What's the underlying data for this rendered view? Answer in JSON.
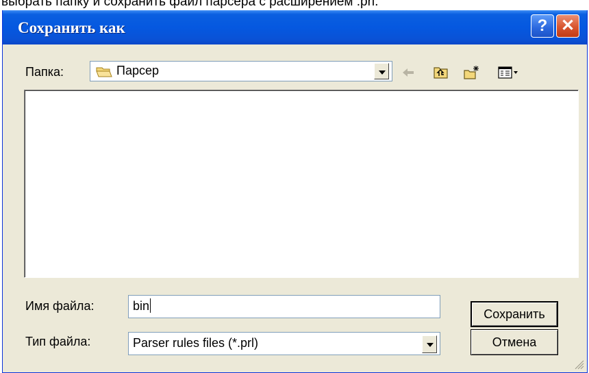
{
  "caption": "выбрать папку и сохранить файл парсера с расширением .prl.",
  "dialog": {
    "title": "Сохранить как",
    "help_label": "?",
    "close_label": "✕",
    "folder_label": "Папка:",
    "folder_value": "Парсер",
    "filename_label": "Имя файла:",
    "filename_value": "bin",
    "filetype_label": "Тип файла:",
    "filetype_value": "Parser rules files (*.prl)",
    "save_label": "Сохранить",
    "cancel_label": "Отмена"
  },
  "icons": [
    "folder-icon",
    "back-arrow-icon",
    "up-folder-icon",
    "new-folder-icon",
    "view-menu-icon",
    "resize-grip-icon"
  ]
}
